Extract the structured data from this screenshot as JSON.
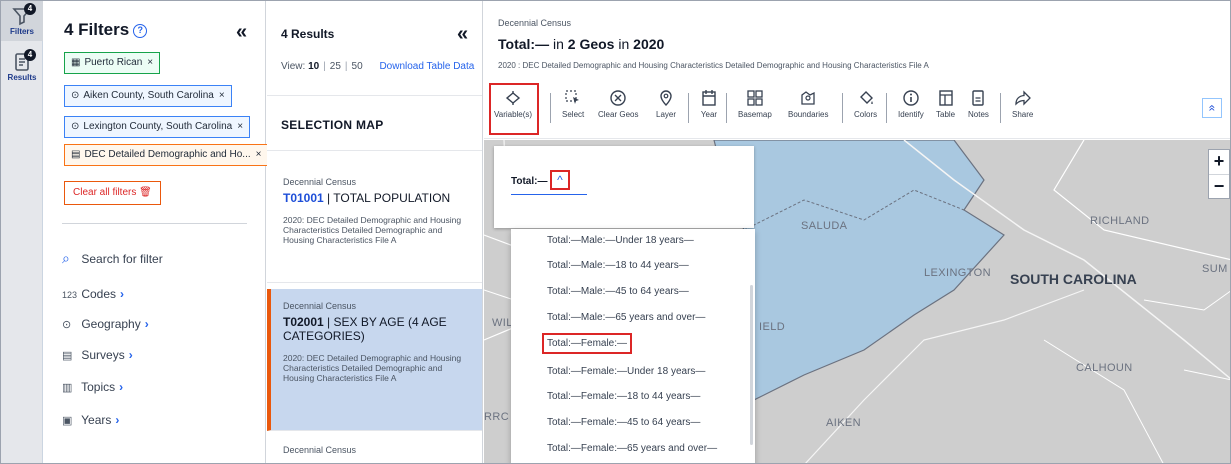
{
  "rail": {
    "filters": {
      "label": "Filters",
      "badge": "4"
    },
    "results": {
      "label": "Results",
      "badge": "4"
    }
  },
  "filters": {
    "title": "4 Filters",
    "collapse": "«",
    "chips": [
      {
        "label": "Puerto Rican",
        "icon": "table-icon",
        "remove": "×"
      },
      {
        "label": "Aiken County, South Carolina",
        "icon": "location-pin-icon",
        "remove": "×"
      },
      {
        "label": "Lexington County, South Carolina",
        "icon": "location-pin-icon",
        "remove": "×"
      },
      {
        "label": "DEC Detailed Demographic and Ho...",
        "icon": "survey-icon",
        "remove": "×"
      }
    ],
    "clear_all": "Clear all filters",
    "search": "Search for filter",
    "nav": [
      {
        "label": "Codes",
        "icon": "123"
      },
      {
        "label": "Geography",
        "icon": "location-pin-icon"
      },
      {
        "label": "Surveys",
        "icon": "survey-icon"
      },
      {
        "label": "Topics",
        "icon": "book-icon"
      },
      {
        "label": "Years",
        "icon": "calendar-icon"
      }
    ]
  },
  "results": {
    "title": "4 Results",
    "collapse": "«",
    "view_label": "View:",
    "view_options": [
      "10",
      "25",
      "50"
    ],
    "download": "Download Table Data",
    "selection_map": "SELECTION MAP",
    "cards": [
      {
        "source": "Decennial Census",
        "code": "T01001",
        "name": "| TOTAL POPULATION",
        "desc": "2020: DEC Detailed Demographic and Housing Characteristics Detailed Demographic and Housing Characteristics File A"
      },
      {
        "source": "Decennial Census",
        "code": "T02001",
        "name": "| SEX BY AGE (4 AGE CATEGORIES)",
        "desc": "2020: DEC Detailed Demographic and Housing Characteristics Detailed Demographic and Housing Characteristics File A"
      },
      {
        "source": "Decennial Census"
      }
    ]
  },
  "main": {
    "source": "Decennial Census",
    "title_total": "Total:—",
    "title_in": "in",
    "title_geos": "2 Geos",
    "title_in2": "in",
    "title_year": "2020",
    "subtitle": "2020 : DEC Detailed Demographic and Housing Characteristics Detailed Demographic and Housing Characteristics File A",
    "toolbar": [
      "Variable(s)",
      "Select",
      "Clear Geos",
      "Layer",
      "Year",
      "Basemap",
      "Boundaries",
      "Colors",
      "Identify",
      "Table",
      "Notes",
      "Share"
    ],
    "collapse_up": "«"
  },
  "map": {
    "labels": {
      "saluda": "SALUDA",
      "richland": "RICHLAND",
      "lexington": "LEXINGTON",
      "south_carolina": "SOUTH CAROLINA",
      "sum": "SUM",
      "wil": "WIL",
      "ield": "IELD",
      "calhoun": "CALHOUN",
      "aiken": "AIKEN",
      "rrc": "RRC"
    },
    "zoom_in": "+",
    "zoom_out": "−",
    "highlight_color": "#a9c8e0"
  },
  "variable_popup": {
    "label": "Total:—",
    "caret": "^",
    "options": [
      "Total:—Male:—Under 18 years—",
      "Total:—Male:—18 to 44 years—",
      "Total:—Male:—45 to 64 years—",
      "Total:—Male:—65 years and over—",
      "Total:—Female:—",
      "Total:—Female:—Under 18 years—",
      "Total:—Female:—18 to 44 years—",
      "Total:—Female:—45 to 64 years—",
      "Total:—Female:—65 years and over—"
    ],
    "highlighted_index": 4
  }
}
